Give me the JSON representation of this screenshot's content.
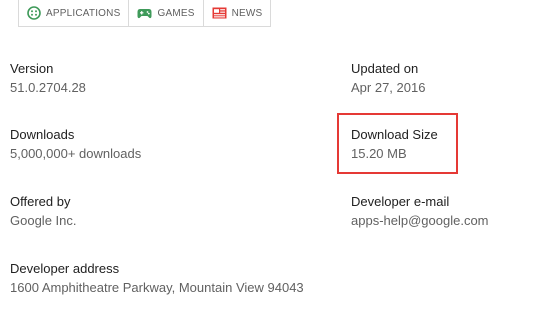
{
  "tabs": [
    {
      "label": "APPLICATIONS",
      "icon": "applications-icon",
      "color": "#3f9a5a"
    },
    {
      "label": "GAMES",
      "icon": "gamepad-icon",
      "color": "#3f9a5a"
    },
    {
      "label": "NEWS",
      "icon": "newspaper-icon",
      "color": "#e53935"
    }
  ],
  "info": {
    "version": {
      "title": "Version",
      "value": "51.0.2704.28"
    },
    "updated": {
      "title": "Updated on",
      "value": "Apr 27, 2016"
    },
    "downloads": {
      "title": "Downloads",
      "value": "5,000,000+ downloads"
    },
    "download_size": {
      "title": "Download Size",
      "value": "15.20 MB"
    },
    "offered_by": {
      "title": "Offered by",
      "value": "Google Inc."
    },
    "developer_email": {
      "title": "Developer e-mail",
      "value": "apps-help@google.com"
    },
    "developer_address": {
      "title": "Developer address",
      "value": "1600 Amphitheatre Parkway, Mountain View 94043"
    }
  },
  "colors": {
    "highlight": "#e53935",
    "accent_green": "#3f9a5a"
  }
}
